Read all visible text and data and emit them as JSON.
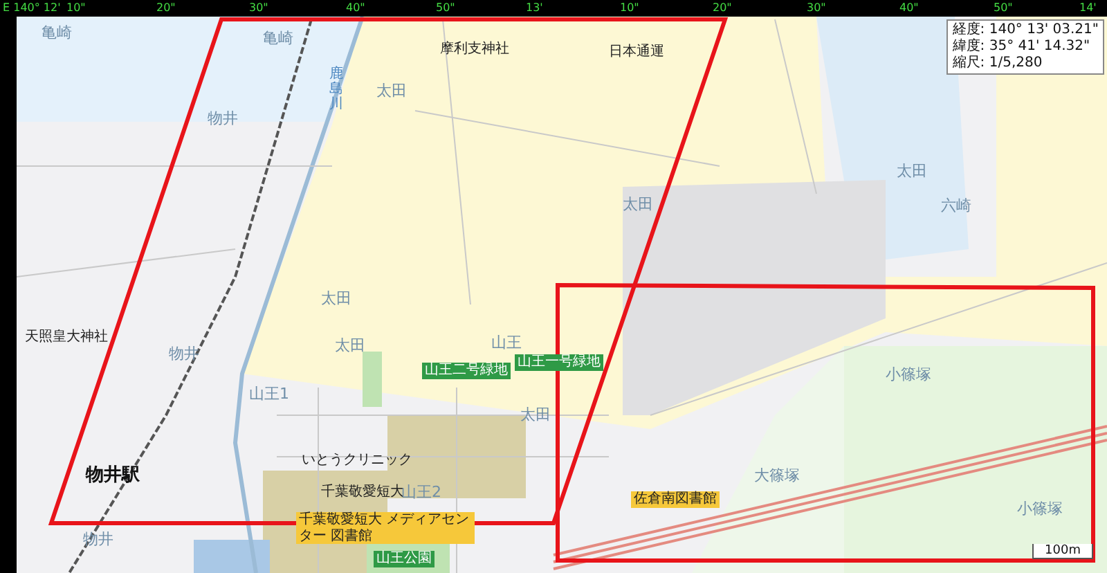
{
  "ruler": {
    "top": [
      "E 140° 12'",
      "10\"",
      "20\"",
      "30\"",
      "40\"",
      "50\"",
      "13'",
      "10\"",
      "20\"",
      "30\"",
      "40\"",
      "50\"",
      "14'"
    ]
  },
  "coordinates": [
    "経度: 140° 13' 03.21\"",
    "緯度: 35° 41' 14.32\"",
    "縮尺: 1/5,280"
  ],
  "labels": [
    {
      "text": "亀崎",
      "kind": "area"
    },
    {
      "text": "亀崎",
      "kind": "area"
    },
    {
      "text": "鹿島川",
      "kind": "river"
    },
    {
      "text": "太田",
      "kind": "area"
    },
    {
      "text": "摩利支神社",
      "kind": "facility"
    },
    {
      "text": "日本通運",
      "kind": "facility"
    },
    {
      "text": "物井",
      "kind": "area"
    },
    {
      "text": "太田",
      "kind": "area"
    },
    {
      "text": "太田",
      "kind": "area"
    },
    {
      "text": "太田",
      "kind": "area"
    },
    {
      "text": "六崎",
      "kind": "area"
    },
    {
      "text": "天照皇大神社",
      "kind": "facility"
    },
    {
      "text": "物井",
      "kind": "area"
    },
    {
      "text": "太田",
      "kind": "area"
    },
    {
      "text": "山王",
      "kind": "area"
    },
    {
      "text": "山王二号緑地",
      "kind": "park"
    },
    {
      "text": "山王一号緑地",
      "kind": "park"
    },
    {
      "text": "山王1",
      "kind": "area"
    },
    {
      "text": "太田",
      "kind": "area"
    },
    {
      "text": "小篠塚",
      "kind": "area"
    },
    {
      "text": "いとうクリニック",
      "kind": "facility"
    },
    {
      "text": "物井駅",
      "kind": "station"
    },
    {
      "text": "千葉敬愛短大",
      "kind": "facility"
    },
    {
      "text": "山王2",
      "kind": "area"
    },
    {
      "text": "佐倉南図書館",
      "kind": "highlight"
    },
    {
      "text": "大篠塚",
      "kind": "area"
    },
    {
      "text": "小篠塚",
      "kind": "area"
    },
    {
      "text": "物井",
      "kind": "area"
    },
    {
      "text": "千葉敬愛短大 メディアセンター 図書館",
      "kind": "highlight"
    },
    {
      "text": "山王公園",
      "kind": "park"
    }
  ],
  "scale": "100m"
}
